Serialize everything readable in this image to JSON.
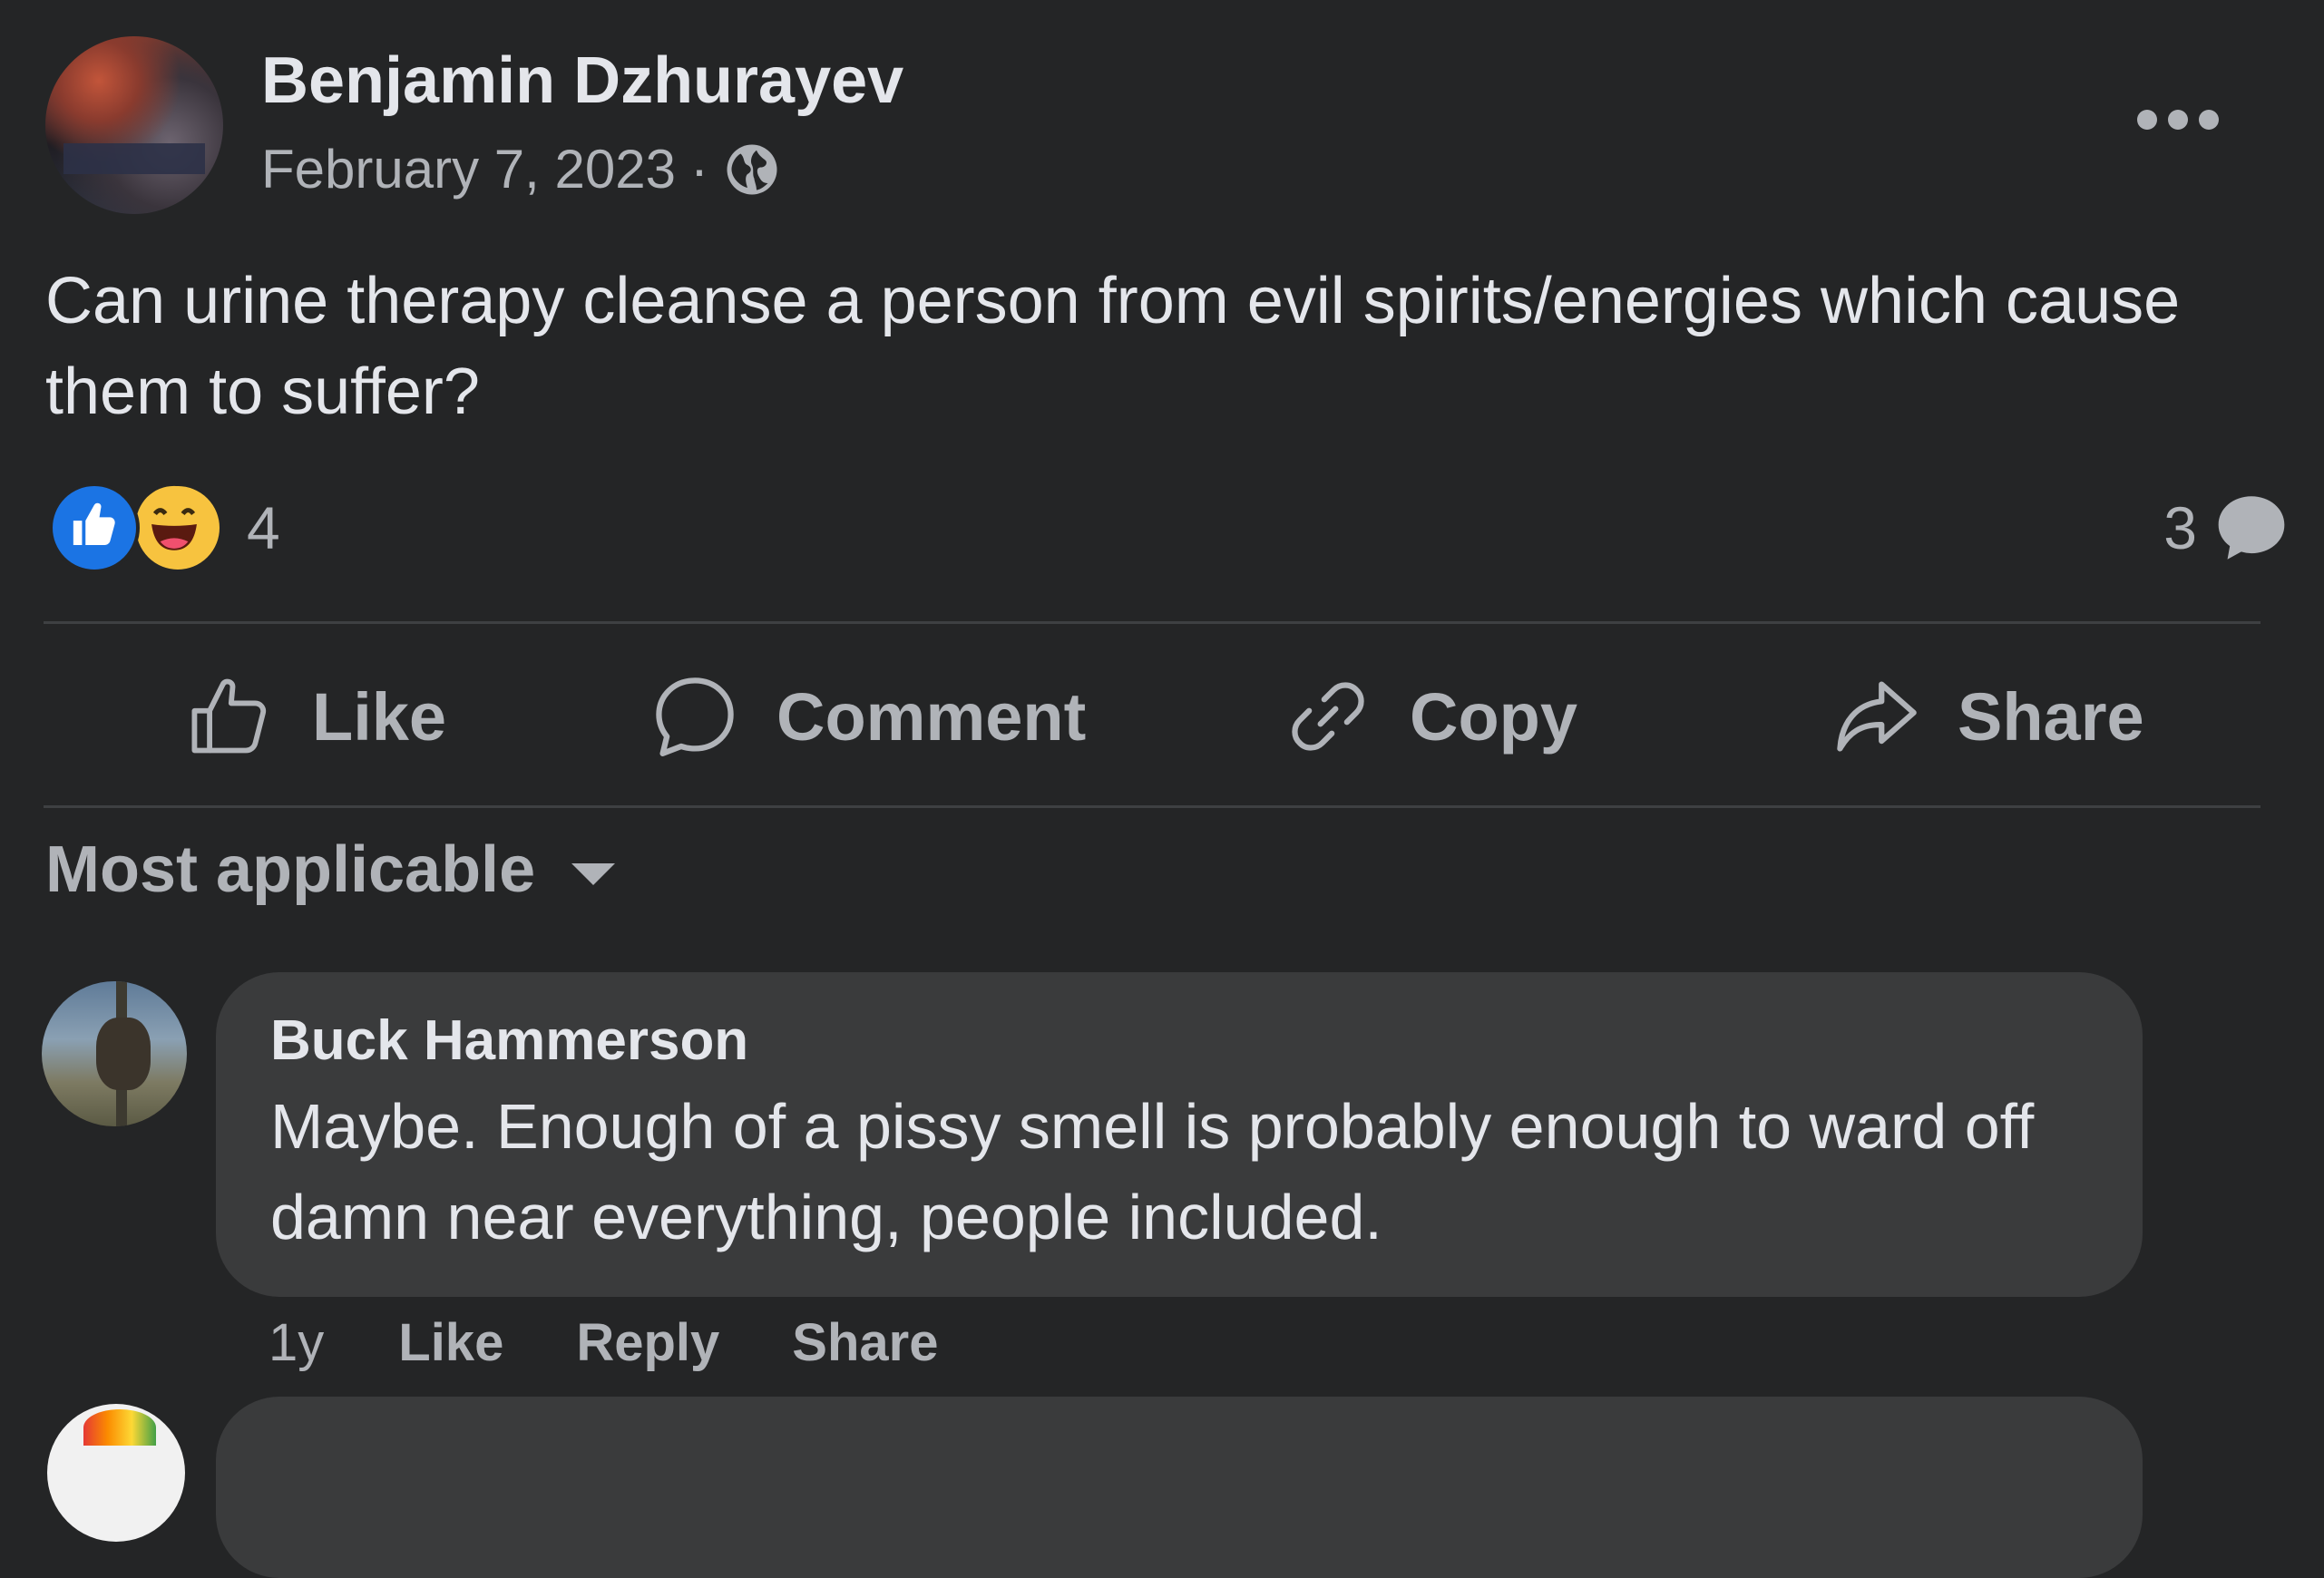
{
  "post": {
    "author": "Benjamin Dzhurayev",
    "date": "February 7, 2023",
    "separator": "·",
    "privacy_icon": "globe-icon",
    "text": "Can urine therapy cleanse a person from evil spirits/energies which cause them to suffer?",
    "reaction_count": "4",
    "reaction_types": [
      "like",
      "haha"
    ],
    "comment_count": "3"
  },
  "actions": {
    "like": "Like",
    "comment": "Comment",
    "copy": "Copy",
    "share": "Share"
  },
  "sort": {
    "label": "Most applicable"
  },
  "comments": [
    {
      "author": "Buck Hammerson",
      "text": "Maybe. Enough of a pissy smell is probably enough to ward off damn near everything, people included.",
      "age": "1y",
      "like": "Like",
      "reply": "Reply",
      "share": "Share"
    }
  ],
  "colors": {
    "background": "#242526",
    "bubble": "#3a3b3c",
    "primary_text": "#e4e6eb",
    "secondary_text": "#b0b3b8",
    "like_blue": "#1b74e4",
    "haha_yellow": "#f7c33f"
  }
}
